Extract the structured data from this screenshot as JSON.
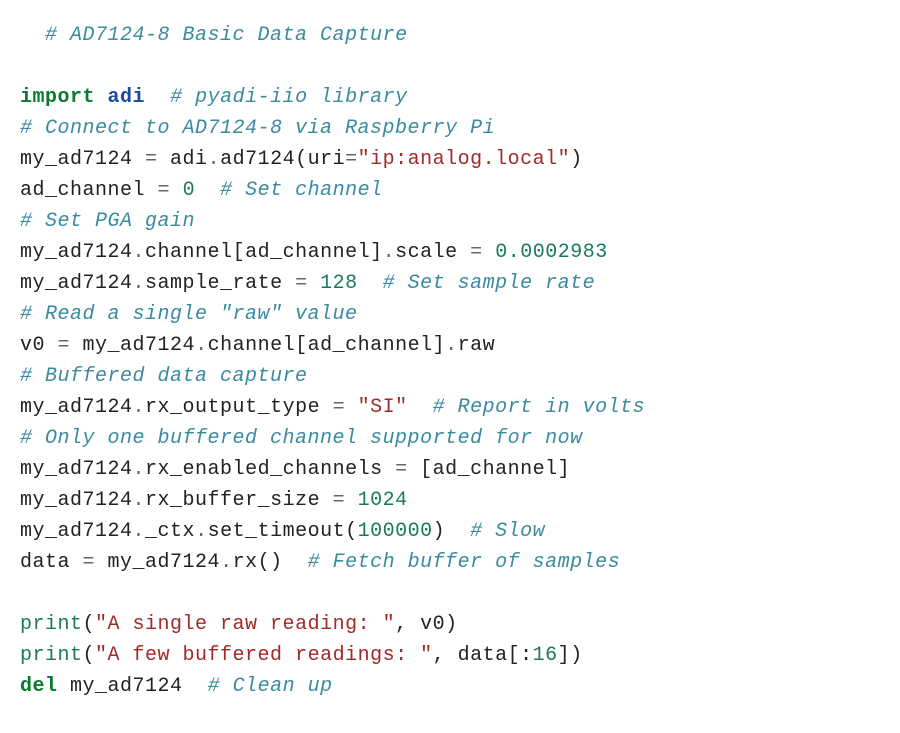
{
  "code": {
    "l1": {
      "indent": "  ",
      "c": "# AD7124-8 Basic Data Capture"
    },
    "l2": "",
    "l3": {
      "kw": "import",
      "sp": " ",
      "mod": "adi",
      "trail": "  ",
      "c": "# pyadi-iio library"
    },
    "l4": {
      "c": "# Connect to AD7124-8 via Raspberry Pi"
    },
    "l5": {
      "a": "my_ad7124 ",
      "op": "=",
      "b": " adi",
      "dot": ".",
      "fn": "ad7124",
      "p1": "(",
      "arg": "uri",
      "eq": "=",
      "str": "\"ip:analog.local\"",
      "p2": ")"
    },
    "l6": {
      "a": "ad_channel ",
      "op": "=",
      "sp": " ",
      "num": "0",
      "trail": "  ",
      "c": "# Set channel"
    },
    "l7": {
      "c": "# Set PGA gain"
    },
    "l8": {
      "a": "my_ad7124",
      "dot1": ".",
      "attr1": "channel",
      "br1": "[",
      "idx": "ad_channel",
      "br2": "]",
      "dot2": ".",
      "attr2": "scale ",
      "op": "=",
      "sp": " ",
      "num": "0.0002983"
    },
    "l9": {
      "a": "my_ad7124",
      "dot": ".",
      "attr": "sample_rate ",
      "op": "=",
      "sp": " ",
      "num": "128",
      "trail": "  ",
      "c": "# Set sample rate"
    },
    "l10": {
      "c": "# Read a single \"raw\" value"
    },
    "l11": {
      "a": "v0 ",
      "op": "=",
      "b": " my_ad7124",
      "dot1": ".",
      "attr1": "channel",
      "br1": "[",
      "idx": "ad_channel",
      "br2": "]",
      "dot2": ".",
      "attr2": "raw"
    },
    "l12": {
      "c": "# Buffered data capture"
    },
    "l13": {
      "a": "my_ad7124",
      "dot": ".",
      "attr": "rx_output_type ",
      "op": "=",
      "sp": " ",
      "str": "\"SI\"",
      "trail": "  ",
      "c": "# Report in volts"
    },
    "l14": {
      "c": "# Only one buffered channel supported for now"
    },
    "l15": {
      "a": "my_ad7124",
      "dot": ".",
      "attr": "rx_enabled_channels ",
      "op": "=",
      "sp": " ",
      "br1": "[",
      "idx": "ad_channel",
      "br2": "]"
    },
    "l16": {
      "a": "my_ad7124",
      "dot": ".",
      "attr": "rx_buffer_size ",
      "op": "=",
      "sp": " ",
      "num": "1024"
    },
    "l17": {
      "a": "my_ad7124",
      "dot1": ".",
      "attr1": "_ctx",
      "dot2": ".",
      "fn": "set_timeout",
      "p1": "(",
      "num": "100000",
      "p2": ")",
      "trail": "  ",
      "c": "# Slow"
    },
    "l18": {
      "a": "data ",
      "op": "=",
      "b": " my_ad7124",
      "dot": ".",
      "fn": "rx",
      "p1": "(",
      "p2": ")",
      "trail": "  ",
      "c": "# Fetch buffer of samples"
    },
    "l19": "",
    "l20": {
      "bi": "print",
      "p1": "(",
      "str": "\"A single raw reading: \"",
      "comma": ", ",
      "arg": "v0",
      "p2": ")"
    },
    "l21": {
      "bi": "print",
      "p1": "(",
      "str": "\"A few buffered readings: \"",
      "comma": ", ",
      "arg": "data",
      "br1": "[",
      "slice": ":",
      "num": "16",
      "br2": "]",
      "p2": ")"
    },
    "l22": {
      "kw": "del",
      "sp": " ",
      "a": "my_ad7124",
      "trail": "  ",
      "c": "# Clean up"
    }
  }
}
